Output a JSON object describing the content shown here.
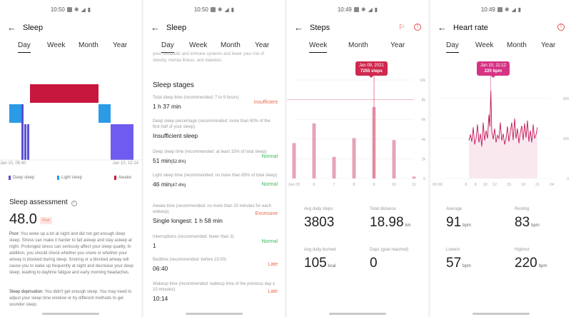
{
  "status_times": [
    "10:50",
    "10:50",
    "10:49",
    "10:49"
  ],
  "sleep_day": {
    "title": "Sleep",
    "tabs": [
      "Day",
      "Week",
      "Month",
      "Year"
    ],
    "x_start": "Jan 10, 06:40",
    "x_end": "Jan 10, 10:14",
    "legend": [
      "Deep sleep",
      "Light sleep",
      "Awake"
    ],
    "assessment_title": "Sleep assessment",
    "score": "48.0",
    "score_badge": "Poor",
    "poor_label": "Poor:",
    "poor_text": "You woke up a lot at night and did not get enough deep sleep. Stress can make it harder to fall asleep and stay asleep at night. Prolonged stress can seriously affect your sleep quality. In addition, you should check whether you snore or whether your airway is blocked during sleep. Snoring or a blocked airway will cause you to wake up frequently at night and decrease your deep sleep, leading to daytime fatigue and early morning headaches.",
    "dep_label": "Sleep deprivation:",
    "dep_text": "You didn't get enough sleep. You may need to adjust your sleep time window or try different methods to get sounder sleep.",
    "colors": {
      "deep": "#5b4fd6",
      "light": "#2b9be6",
      "awake": "#c8173f",
      "awake_big": "#6e5cf0"
    }
  },
  "sleep_stages": {
    "title": "Sleep",
    "tabs": [
      "Day",
      "Week",
      "Month",
      "Year"
    ],
    "intro": "your metabolic and immune systems and lower your risk of obesity, mental illness, and diabetes.",
    "heading": "Sleep stages",
    "items": [
      {
        "label": "Total sleep time (recommended: 7 to 9 hours)",
        "value": "1 h 37 min",
        "status": "Insufficient",
        "status_color": "#e56a4c"
      },
      {
        "label": "Deep sleep percentage (recommended: more than 60% of the first half of your sleep)",
        "value": "Insufficient sleep",
        "status": "",
        "status_color": "#e56a4c"
      },
      {
        "label": "Deep sleep time (recommended: at least 15% of total sleep)",
        "value": "51 min",
        "value_small": "(52.6%)",
        "status": "Normal",
        "status_color": "#3fb65e"
      },
      {
        "label": "Light sleep time (recommended: no more than 65% of total sleep)",
        "value": "46 min",
        "value_small": "(47.4%)",
        "status": "Normal",
        "status_color": "#3fb65e"
      },
      {
        "label": "Awake time (recommended: no more than 20 minutes for each wakeup)",
        "value": "Single longest: 1 h 58 min",
        "status": "Excessive",
        "status_color": "#e56a4c"
      },
      {
        "label": "Interruptions (recommended: fewer than 3)",
        "value": "1",
        "status": "Normal",
        "status_color": "#3fb65e"
      },
      {
        "label": "Bedtime (recommended: before 23:00)",
        "value": "06:40",
        "status": "Late",
        "status_color": "#e56a4c"
      },
      {
        "label": "Wakeup time (recommended: wakeup time of the previous day ± 15 minutes)",
        "value": "10:14",
        "status": "Late",
        "status_color": "#e56a4c"
      }
    ]
  },
  "steps": {
    "title": "Steps",
    "tabs": [
      "Week",
      "Month",
      "Year"
    ],
    "tooltip_date": "Jan 09, 2021",
    "tooltip_value": "7255 steps",
    "stats": [
      {
        "label": "Avg daily steps",
        "value": "3803",
        "unit": ""
      },
      {
        "label": "Total distance",
        "value": "18.98",
        "unit": "km"
      },
      {
        "label": "Avg daily burned",
        "value": "105",
        "unit": "kcal"
      },
      {
        "label": "Days (goal reached)",
        "value": "0",
        "unit": ""
      }
    ],
    "colors": {
      "bar": "#e7a3b6",
      "accent": "#e0264e"
    }
  },
  "heart": {
    "title": "Heart rate",
    "tabs": [
      "Day",
      "Week",
      "Month",
      "Year"
    ],
    "tooltip_date": "Jan 10, 11:12",
    "tooltip_value": "220 bpm",
    "stats": [
      {
        "label": "Average",
        "value": "91",
        "unit": "bpm"
      },
      {
        "label": "Resting",
        "value": "83",
        "unit": "bpm"
      },
      {
        "label": "Lowest",
        "value": "57",
        "unit": "bpm"
      },
      {
        "label": "Highest",
        "value": "220",
        "unit": "bpm"
      }
    ],
    "colors": {
      "line": "#c2185b"
    }
  },
  "chart_data": [
    {
      "type": "bar",
      "title": "Steps",
      "categories": [
        "Jan 05",
        "6",
        "7",
        "8",
        "9",
        "10",
        "11"
      ],
      "values": [
        3600,
        5600,
        2200,
        4100,
        7255,
        3900,
        200
      ],
      "y_ticks": [
        "0",
        "2k",
        "4k",
        "6k",
        "8k",
        "10k"
      ],
      "ylim": [
        0,
        10000
      ],
      "reference_line": 8000,
      "highlight_index": 4
    },
    {
      "type": "line",
      "title": "Heart rate",
      "x_ticks": [
        "00:00",
        "6",
        "8",
        "10",
        "12",
        "15",
        "18",
        "21",
        "24"
      ],
      "y_ticks": [
        "0",
        "100",
        "200"
      ],
      "ylim": [
        0,
        250
      ],
      "x": [
        6.6,
        6.9,
        7.2,
        7.5,
        7.8,
        8.1,
        8.4,
        8.7,
        9.0,
        9.3,
        9.6,
        9.9,
        10.2,
        10.5,
        10.8,
        11.0,
        11.2,
        11.4,
        11.7,
        12.0,
        12.3,
        12.6,
        12.9,
        13.2,
        13.5,
        13.8,
        14.1,
        14.4,
        14.7,
        15.0,
        15.3,
        15.6,
        15.9,
        16.2,
        16.5,
        16.8,
        17.1,
        17.4,
        17.7,
        18.0,
        18.3,
        18.6,
        18.9,
        19.2,
        19.5,
        19.8,
        20.1,
        20.4,
        20.7,
        21.0
      ],
      "values": [
        95,
        110,
        92,
        128,
        85,
        100,
        135,
        90,
        112,
        80,
        140,
        95,
        120,
        100,
        160,
        130,
        220,
        118,
        98,
        125,
        90,
        108,
        100,
        140,
        95,
        112,
        85,
        100,
        130,
        92,
        118,
        140,
        96,
        150,
        100,
        125,
        88,
        115,
        132,
        96,
        138,
        102,
        145,
        92,
        120,
        90,
        135,
        100,
        110,
        128
      ]
    }
  ]
}
